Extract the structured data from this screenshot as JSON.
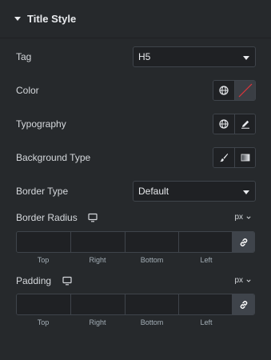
{
  "section": {
    "title": "Title Style"
  },
  "tag": {
    "label": "Tag",
    "value": "H5"
  },
  "color": {
    "label": "Color"
  },
  "typography": {
    "label": "Typography"
  },
  "background_type": {
    "label": "Background Type"
  },
  "border_type": {
    "label": "Border Type",
    "value": "Default"
  },
  "border_radius": {
    "label": "Border Radius",
    "unit": "px",
    "fields": [
      "Top",
      "Right",
      "Bottom",
      "Left"
    ]
  },
  "padding": {
    "label": "Padding",
    "unit": "px",
    "fields": [
      "Top",
      "Right",
      "Bottom",
      "Left"
    ]
  },
  "colors": {
    "background": "#26292c",
    "input_bg": "#1f2124",
    "border": "#3f444b",
    "text": "#d5d8dc"
  },
  "icons": [
    "caret-down-icon",
    "globe-icon",
    "color-swatch-icon",
    "pencil-icon",
    "brush-icon",
    "gradient-icon",
    "monitor-icon",
    "chevron-down-icon",
    "link-icon"
  ]
}
